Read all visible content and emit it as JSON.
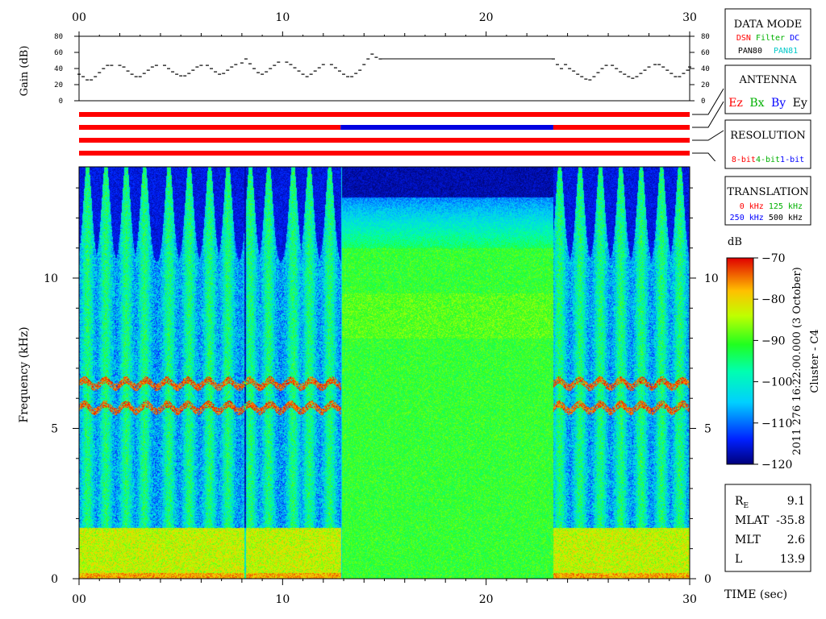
{
  "chart_data": [
    {
      "type": "line",
      "name": "gain-panel",
      "ylabel": "Gain (dB)",
      "xlim": [
        0,
        30
      ],
      "ylim": [
        0,
        80
      ],
      "x_ticks": [
        "00",
        "10",
        "20",
        "30"
      ],
      "y_ticks": [
        "0",
        "20",
        "40",
        "60",
        "80"
      ],
      "segments": [
        [
          [
            0.0,
            33
          ],
          [
            0.2,
            30
          ],
          [
            0.4,
            26
          ],
          [
            0.6,
            26
          ],
          [
            0.8,
            30
          ],
          [
            1.0,
            35
          ],
          [
            1.2,
            40
          ],
          [
            1.4,
            44
          ],
          [
            1.6,
            44
          ],
          [
            2.0,
            44
          ],
          [
            2.2,
            42
          ],
          [
            2.4,
            37
          ],
          [
            2.6,
            33
          ],
          [
            2.8,
            30
          ],
          [
            3.0,
            30
          ],
          [
            3.2,
            34
          ],
          [
            3.4,
            38
          ],
          [
            3.6,
            42
          ],
          [
            3.8,
            44
          ],
          [
            4.2,
            44
          ],
          [
            4.4,
            40
          ],
          [
            4.6,
            36
          ],
          [
            4.8,
            33
          ],
          [
            5.0,
            31
          ],
          [
            5.2,
            31
          ],
          [
            5.4,
            34
          ],
          [
            5.6,
            38
          ],
          [
            5.8,
            42
          ],
          [
            6.0,
            44
          ],
          [
            6.3,
            44
          ],
          [
            6.5,
            40
          ],
          [
            6.7,
            36
          ],
          [
            6.9,
            33
          ],
          [
            7.1,
            34
          ],
          [
            7.3,
            38
          ],
          [
            7.5,
            42
          ],
          [
            7.7,
            45
          ],
          [
            8.0,
            47
          ],
          [
            8.2,
            52
          ],
          [
            8.4,
            46
          ],
          [
            8.6,
            40
          ],
          [
            8.8,
            35
          ],
          [
            9.0,
            33
          ],
          [
            9.2,
            36
          ],
          [
            9.4,
            40
          ],
          [
            9.6,
            44
          ],
          [
            9.8,
            48
          ],
          [
            10.2,
            48
          ],
          [
            10.4,
            45
          ],
          [
            10.6,
            41
          ],
          [
            10.8,
            37
          ],
          [
            11.0,
            33
          ],
          [
            11.2,
            30
          ],
          [
            11.4,
            33
          ],
          [
            11.6,
            37
          ],
          [
            11.8,
            41
          ],
          [
            12.0,
            45
          ],
          [
            12.4,
            45
          ],
          [
            12.6,
            41
          ],
          [
            12.8,
            37
          ],
          [
            13.0,
            33
          ],
          [
            13.2,
            30
          ],
          [
            13.4,
            30
          ],
          [
            13.6,
            34
          ],
          [
            13.8,
            38
          ],
          [
            14.0,
            45
          ],
          [
            14.2,
            52
          ],
          [
            14.4,
            58
          ],
          [
            14.6,
            54
          ],
          [
            14.8,
            52
          ]
        ],
        [
          [
            14.8,
            52
          ],
          [
            23.3,
            52
          ]
        ],
        [
          [
            23.3,
            52
          ],
          [
            23.5,
            45
          ],
          [
            23.7,
            40
          ],
          [
            23.9,
            45
          ],
          [
            24.1,
            40
          ],
          [
            24.3,
            37
          ],
          [
            24.5,
            33
          ],
          [
            24.7,
            30
          ],
          [
            24.9,
            27
          ],
          [
            25.1,
            26
          ],
          [
            25.3,
            30
          ],
          [
            25.5,
            35
          ],
          [
            25.7,
            40
          ],
          [
            25.9,
            44
          ],
          [
            26.2,
            44
          ],
          [
            26.4,
            40
          ],
          [
            26.6,
            36
          ],
          [
            26.8,
            33
          ],
          [
            27.0,
            30
          ],
          [
            27.2,
            28
          ],
          [
            27.4,
            30
          ],
          [
            27.6,
            34
          ],
          [
            27.8,
            38
          ],
          [
            28.0,
            42
          ],
          [
            28.3,
            45
          ],
          [
            28.5,
            45
          ],
          [
            28.7,
            42
          ],
          [
            28.9,
            38
          ],
          [
            29.1,
            34
          ],
          [
            29.3,
            30
          ],
          [
            29.5,
            30
          ],
          [
            29.7,
            34
          ],
          [
            29.9,
            38
          ],
          [
            30.0,
            42
          ]
        ]
      ]
    },
    {
      "type": "heatmap",
      "name": "spectrogram",
      "ylabel": "Frequency (kHz)",
      "xlabel": "TIME (sec)",
      "xlim": [
        0,
        30
      ],
      "ylim": [
        0,
        13.7
      ],
      "x_ticks": [
        "00",
        "10",
        "20",
        "30"
      ],
      "y_ticks": [
        "0",
        "5",
        "10"
      ],
      "colorbar": {
        "label": "dB",
        "min": -120,
        "max": -70,
        "ticks": [
          "-70",
          "-80",
          "-90",
          "-100",
          "-110",
          "-120"
        ]
      },
      "regions": [
        {
          "x": [
            0,
            12.85
          ],
          "mode": "burst"
        },
        {
          "x": [
            12.85,
            23.3
          ],
          "mode": "uniform"
        },
        {
          "x": [
            23.3,
            30
          ],
          "mode": "burst"
        }
      ],
      "emission_lines_khz": [
        6.5,
        5.7
      ]
    }
  ],
  "data_mode": {
    "title": "DATA MODE",
    "row1": [
      {
        "text": "DSN",
        "color": "#ff0000"
      },
      {
        "text": "Filter",
        "color": "#00b000"
      },
      {
        "text": "DC",
        "color": "#0000ff"
      }
    ],
    "row2": [
      {
        "text": "PAN80",
        "color": "#000000"
      },
      {
        "text": "PAN81",
        "color": "#00c8c8"
      }
    ]
  },
  "antenna": {
    "title": "ANTENNA",
    "items": [
      {
        "text": "Ez",
        "color": "#ff0000"
      },
      {
        "text": "Bx",
        "color": "#00b000"
      },
      {
        "text": "By",
        "color": "#0000ff"
      },
      {
        "text": "Ey",
        "color": "#000000"
      }
    ]
  },
  "resolution": {
    "title": "RESOLUTION",
    "items": [
      {
        "text": "8-bit",
        "color": "#ff0000"
      },
      {
        "text": "4-bit",
        "color": "#00b000"
      },
      {
        "text": "1-bit",
        "color": "#0000ff"
      }
    ]
  },
  "translation": {
    "title": "TRANSLATION",
    "row1": [
      {
        "text": "0 kHz",
        "color": "#ff0000"
      },
      {
        "text": "125 kHz",
        "color": "#00b000"
      }
    ],
    "row2": [
      {
        "text": "250 kHz",
        "color": "#0000ff"
      },
      {
        "text": "500 kHz",
        "color": "#000000"
      }
    ]
  },
  "status_bars": [
    {
      "segments": [
        {
          "from": 0,
          "to": 30,
          "color": "#ff0000"
        }
      ]
    },
    {
      "segments": [
        {
          "from": 0,
          "to": 12.85,
          "color": "#ff0000"
        },
        {
          "from": 12.85,
          "to": 23.3,
          "color": "#0000e0"
        },
        {
          "from": 23.3,
          "to": 30,
          "color": "#ff0000"
        }
      ]
    },
    {
      "segments": [
        {
          "from": 0,
          "to": 30,
          "color": "#ff0000"
        }
      ]
    },
    {
      "segments": [
        {
          "from": 0,
          "to": 30,
          "color": "#ff0000"
        }
      ]
    }
  ],
  "timestamp": "2011 276 16:22:00.000 (3 October)",
  "spacecraft": "Cluster - C4",
  "orbit": [
    {
      "label": "R",
      "sub": "E",
      "value": "9.1"
    },
    {
      "label": "MLAT",
      "value": "-35.8"
    },
    {
      "label": "MLT",
      "value": "2.6"
    },
    {
      "label": "L",
      "value": "13.9"
    }
  ]
}
